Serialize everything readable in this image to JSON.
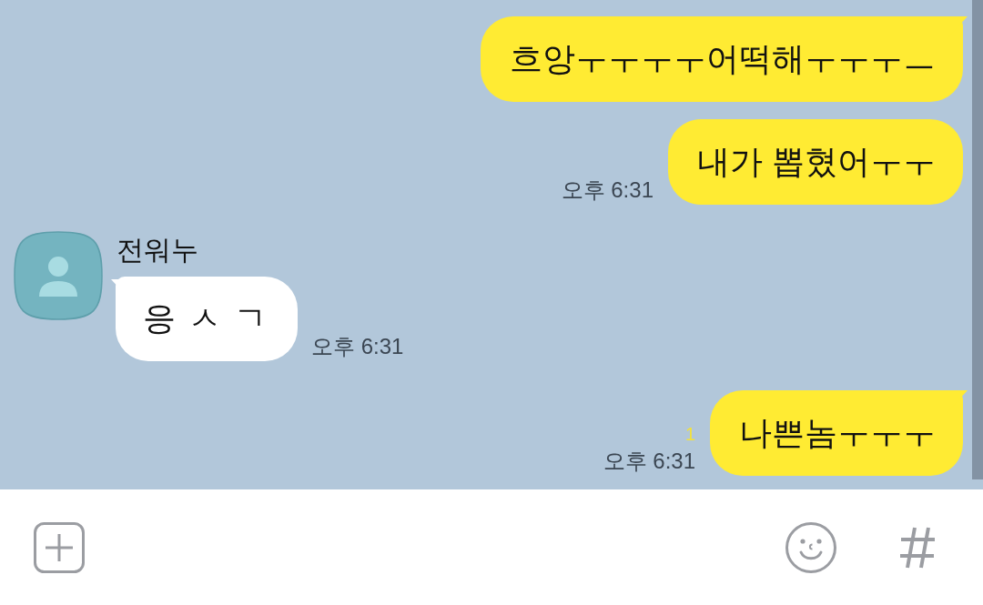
{
  "chat": {
    "messages": [
      {
        "kind": "outgoing",
        "text": "흐앙ㅜㅜㅜㅜ어떡해ㅜㅜㅜㅡ"
      },
      {
        "kind": "outgoing",
        "text": "내가 뽑혔어ㅜㅜ",
        "time": "오후 6:31"
      },
      {
        "kind": "incoming",
        "sender": "전워누",
        "text": "응 ㅅ ㄱ",
        "time": "오후 6:31"
      },
      {
        "kind": "outgoing",
        "text": "나쁜놈ㅜㅜㅜ",
        "unread": "1",
        "time": "오후 6:31"
      }
    ]
  }
}
